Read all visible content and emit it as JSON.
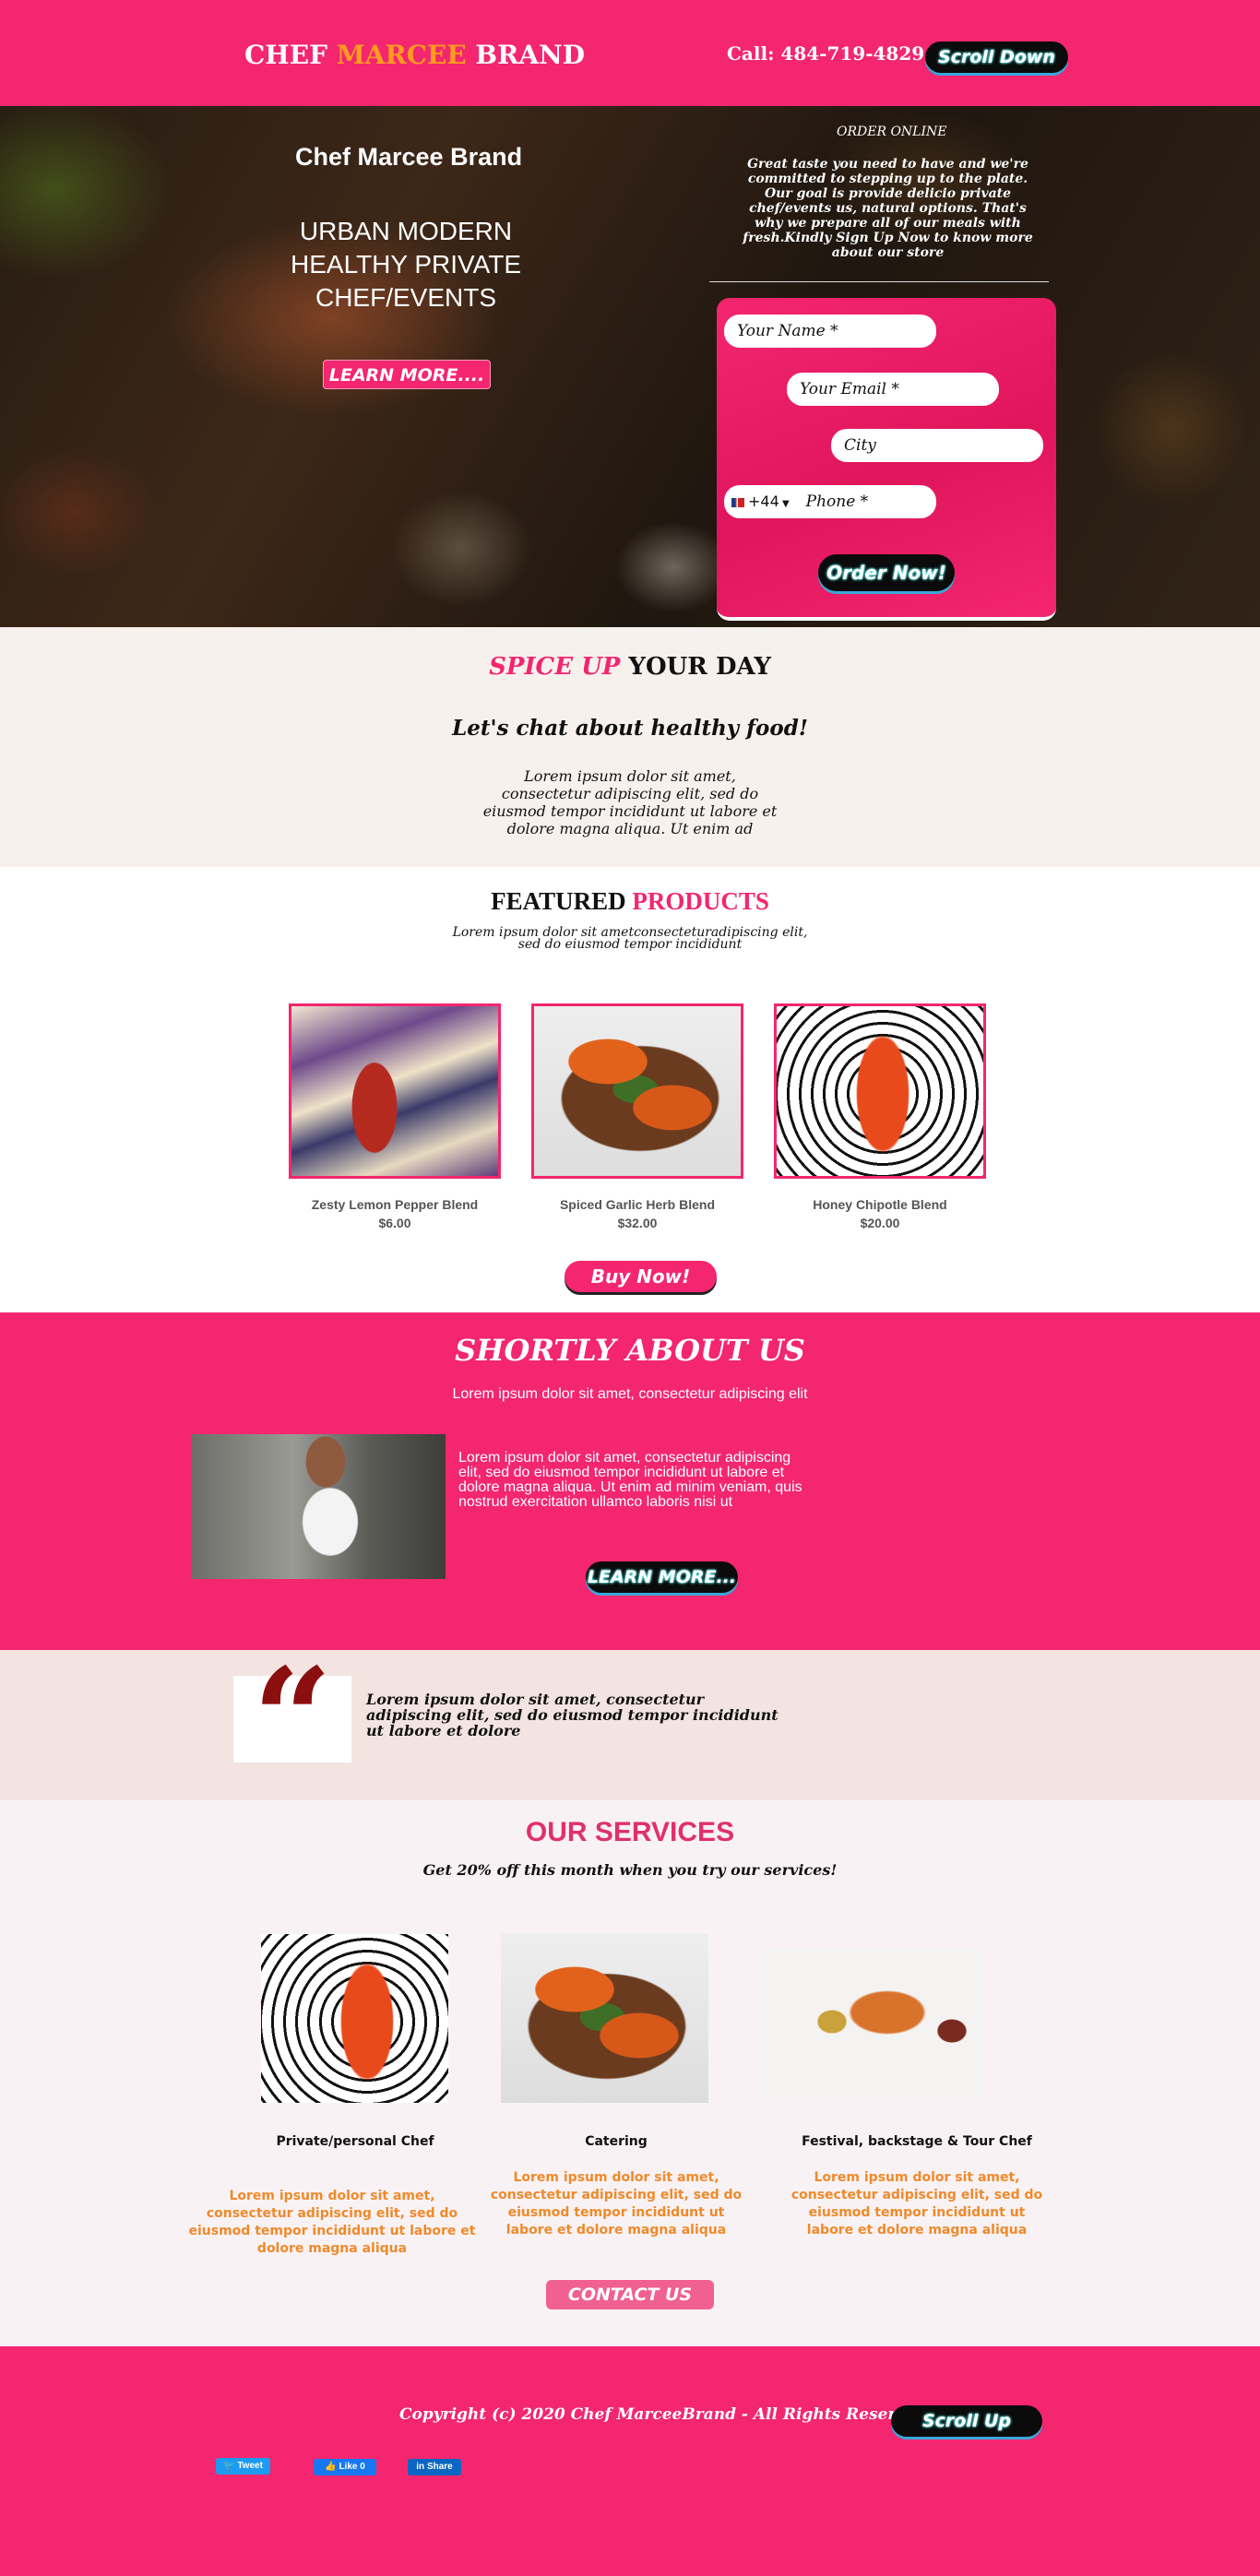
{
  "header": {
    "brand_part1": "CHEF ",
    "brand_part2": "MARCEE",
    "brand_part3": " BRAND",
    "call": "Call: 484-719-4829",
    "scroll_down": "Scroll Down"
  },
  "hero": {
    "brand": "Chef Marcee Brand",
    "title": "URBAN MODERN HEALTHY PRIVATE CHEF/EVENTS",
    "learn_more": "LEARN MORE....",
    "order_label": "ORDER ONLINE",
    "order_text": "Great taste you need to have and we're committed to stepping up to the plate. Our goal is provide delicio private chef/events us, natural options. That's why we prepare all of our meals with fresh.Kindly Sign Up Now to know more about our store"
  },
  "form": {
    "name": "Your Name *",
    "email": "Your Email *",
    "city": "City",
    "phone_code": "+44",
    "phone": "Phone *",
    "submit": "Order Now!"
  },
  "spice": {
    "title_pink": "SPICE UP",
    "title_rest": " YOUR DAY",
    "subtitle": "Let's chat about healthy food!",
    "body": "Lorem ipsum dolor sit amet, consectetur adipiscing elit, sed do eiusmod tempor incididunt ut labore et dolore magna aliqua. Ut enim ad"
  },
  "featured": {
    "title_black": "FEATURED ",
    "title_pink": "PRODUCTS",
    "subtitle": "Lorem ipsum dolor sit ametconsecteturadipiscing elit, sed do eiusmod tempor incididunt",
    "products": [
      {
        "name": "Zesty Lemon Pepper Blend",
        "price": "$6.00",
        "image": "spice-jar-photo"
      },
      {
        "name": "Spiced Garlic Herb Blend",
        "price": "$32.00",
        "image": "toast-photo"
      },
      {
        "name": "Honey Chipotle Blend",
        "price": "$20.00",
        "image": "plate-photo"
      }
    ],
    "buy_now": "Buy Now!"
  },
  "about": {
    "title": "SHORTLY ABOUT  US",
    "subtitle": "Lorem ipsum dolor sit amet, consectetur adipiscing elit",
    "body": "Lorem ipsum dolor sit amet, consectetur adipiscing elit, sed do eiusmod tempor incididunt ut labore et dolore magna aliqua. Ut enim ad minim veniam, quis nostrud exercitation ullamco laboris nisi ut",
    "learn_more": "LEARN MORE..."
  },
  "quote": {
    "mark": "“",
    "text": "Lorem ipsum dolor sit amet, consectetur adipiscing elit, sed do eiusmod tempor incididunt ut labore et dolore"
  },
  "services": {
    "title": "OUR SERVICES",
    "subtitle": "Get 20% off this month when you try  our services!",
    "items": [
      {
        "name": "Private/personal Chef",
        "body": "Lorem ipsum dolor sit amet, consectetur adipiscing elit, sed do eiusmod tempor incididunt ut labore et dolore magna aliqua"
      },
      {
        "name": "Catering",
        "body": "Lorem ipsum dolor sit amet, consectetur adipiscing elit, sed do eiusmod tempor incididunt ut labore et dolore magna aliqua"
      },
      {
        "name": "Festival, backstage & Tour Chef",
        "body": "Lorem ipsum dolor sit amet, consectetur adipiscing elit, sed do eiusmod tempor incididunt ut labore et dolore magna aliqua"
      }
    ],
    "contact": "CONTACT US"
  },
  "footer": {
    "copyright": "Copyright (c) 2020 Chef MarceeBrand - All Rights Reserved",
    "scroll_up": "Scroll Up",
    "tweet": "Tweet",
    "like": "Like 0",
    "share": "Share"
  },
  "colors": {
    "brand_pink": "#f3266f",
    "accent_orange": "#ff9c1f",
    "service_text": "#ef8a2a",
    "quote_red": "#8b0f0f"
  }
}
